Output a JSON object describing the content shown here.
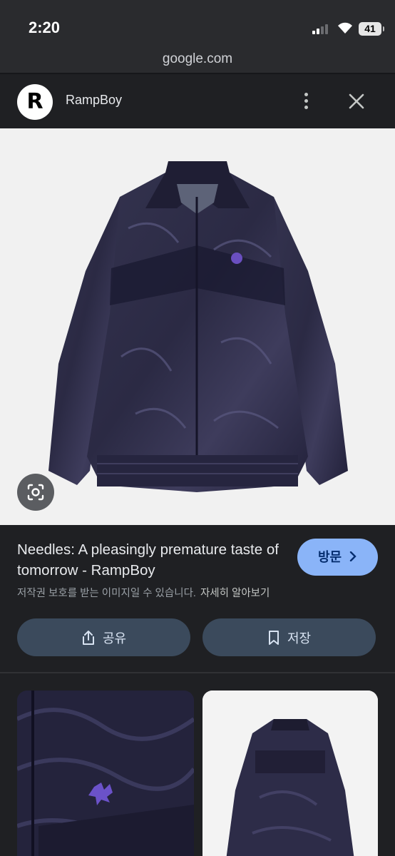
{
  "status_bar": {
    "time": "2:20",
    "battery": "41"
  },
  "browser": {
    "url": "google.com"
  },
  "source": {
    "logo_letter": "R",
    "name": "RampBoy"
  },
  "result": {
    "title": "Needles: A pleasingly premature taste of tomorrow - RampBoy",
    "visit_label": "방문",
    "copyright_notice": "저작권 보호를 받는 이미지일 수 있습니다.",
    "learn_more": "자세히 알아보기",
    "share_label": "공유",
    "save_label": "저장"
  },
  "colors": {
    "background": "#1f2023",
    "visit_button": "#8ab4f8",
    "action_button": "#3b4a5c",
    "jacket": "#2b2a48"
  },
  "icons": [
    "wifi-icon",
    "more-icon",
    "close-icon",
    "lens-icon",
    "share-icon",
    "bookmark-icon",
    "chevron-right-icon"
  ]
}
